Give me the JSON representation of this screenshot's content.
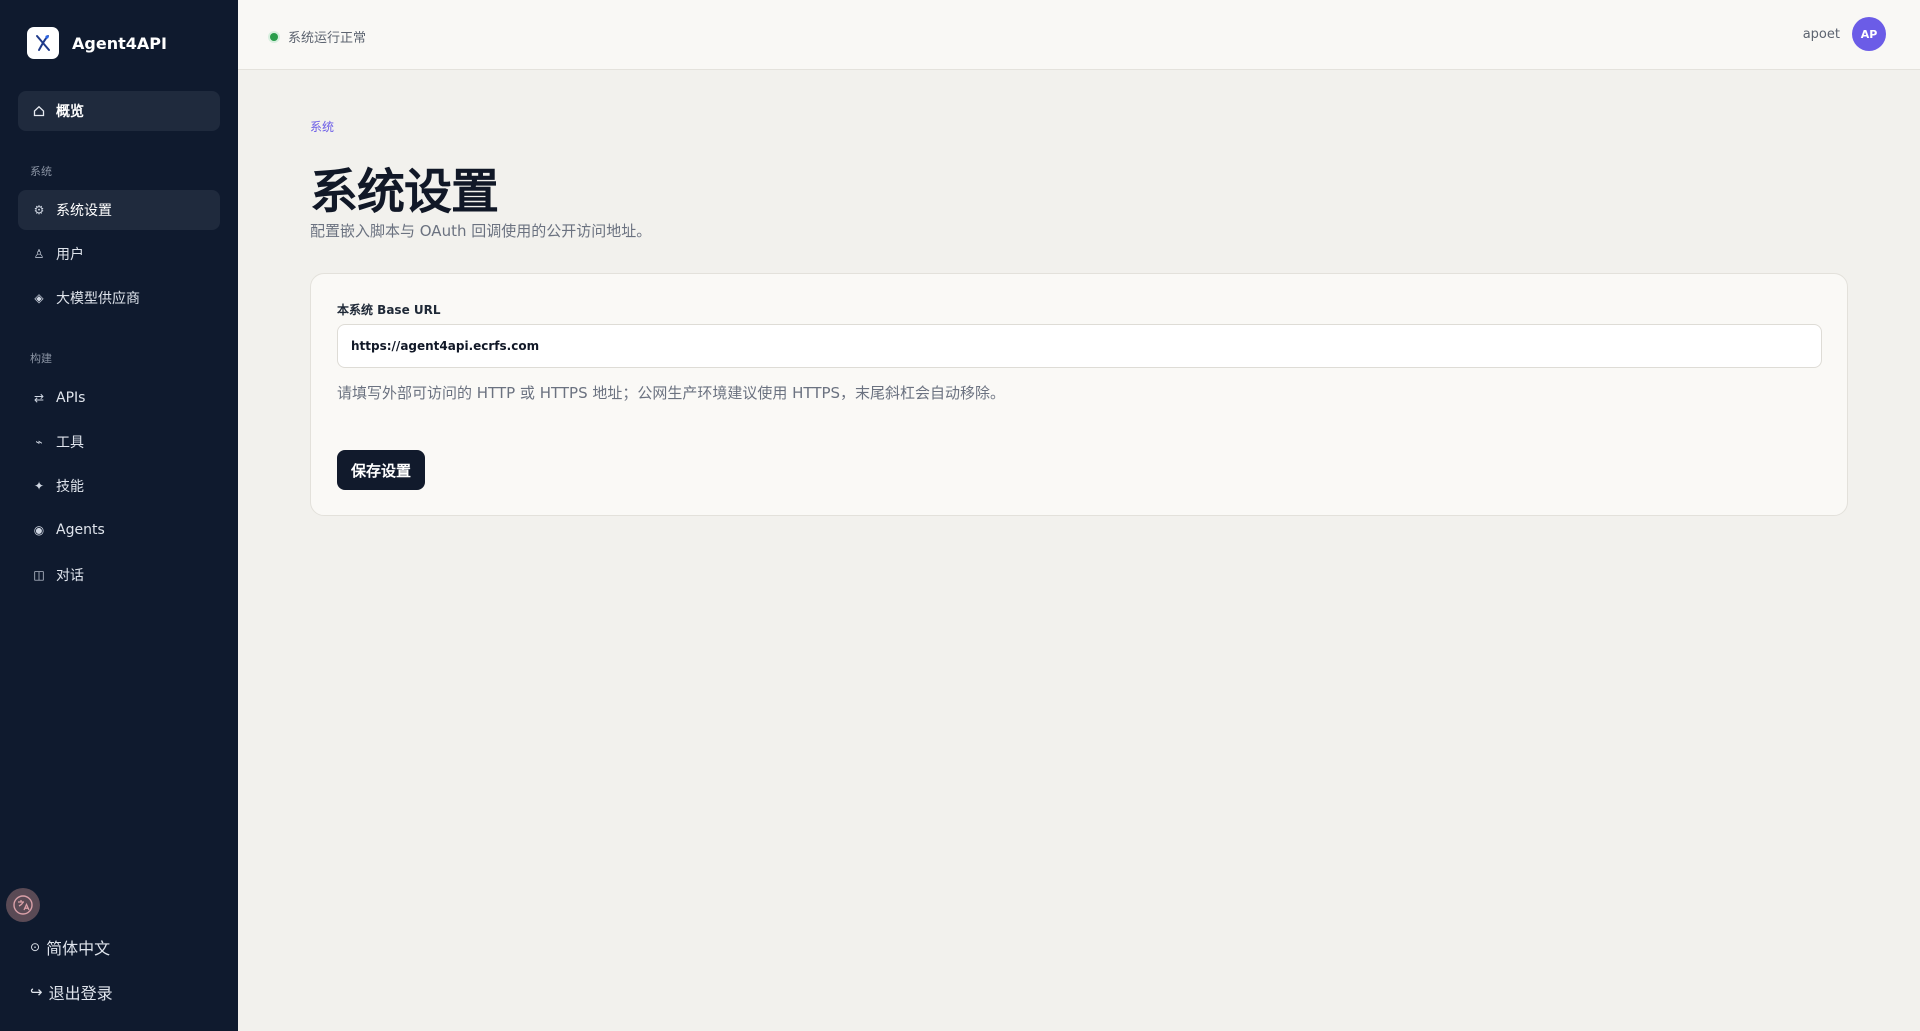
{
  "brand": {
    "name": "Agent4API",
    "logo_icon": "agent-logo-icon"
  },
  "sidebar": {
    "overview": {
      "label": "概览",
      "icon": "home-icon"
    },
    "sections": [
      {
        "label": "系统"
      },
      {
        "label": "构建"
      }
    ],
    "system_items": [
      {
        "label": "系统设置",
        "icon": "gear-icon",
        "active": true
      },
      {
        "label": "用户",
        "icon": "user-icon"
      },
      {
        "label": "大模型供应商",
        "icon": "diamond-icon"
      }
    ],
    "build_items": [
      {
        "label": "APIs",
        "icon": "swap-icon"
      },
      {
        "label": "工具",
        "icon": "wrench-icon"
      },
      {
        "label": "技能",
        "icon": "sparkle-icon"
      },
      {
        "label": "Agents",
        "icon": "agent-dot-icon"
      },
      {
        "label": "对话",
        "icon": "chat-panel-icon"
      }
    ],
    "language": "简体中文",
    "logout": "退出登录"
  },
  "topbar": {
    "status": "系统运行正常",
    "username": "apoet",
    "avatar_initials": "AP"
  },
  "page": {
    "eyebrow": "系统",
    "title": "系统设置",
    "description": "配置嵌入脚本与 OAuth 回调使用的公开访问地址。"
  },
  "form": {
    "base_url_label": "本系统 Base URL",
    "base_url_value": "https://agent4api.ecrfs.com",
    "help": "请填写外部可访问的 HTTP 或 HTTPS 地址；公网生产环境建议使用 HTTPS，末尾斜杠会自动移除。",
    "save_label": "保存设置"
  },
  "colors": {
    "sidebar_bg": "#0f1a2e",
    "accent": "#6b5ce7",
    "status_ok": "#2a9d4b",
    "button_bg": "#111a2c"
  }
}
